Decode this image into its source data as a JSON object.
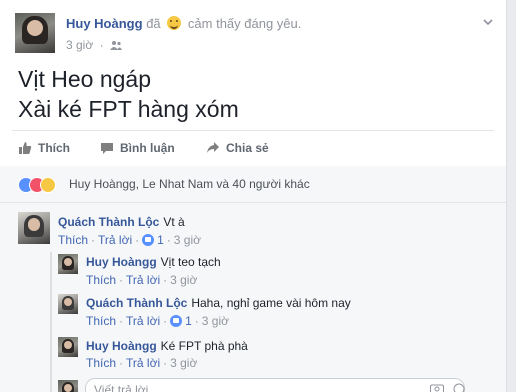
{
  "post": {
    "author": "Huy Hoàngg",
    "feeling_prefix": "đã",
    "feeling_text": "cảm thấy đáng yêu.",
    "time": "3 giờ",
    "text_line1": "Vịt Heo ngáp",
    "text_line2": "Xài ké FPT hàng xóm"
  },
  "actions": {
    "like": "Thích",
    "comment": "Bình luận",
    "share": "Chia sẻ"
  },
  "reactions": {
    "summary": "Huy Hoàngg, Le Nhat Nam và 40 người khác"
  },
  "comments": [
    {
      "author": "Quách Thành Lộc",
      "text": "Vt à",
      "like": "Thích",
      "reply": "Trả lời",
      "likes": "1",
      "time": "3 giờ",
      "replies": [
        {
          "author": "Huy Hoàngg",
          "text": "Vịt teo tạch",
          "like": "Thích",
          "reply": "Trả lời",
          "time": "3 giờ"
        },
        {
          "author": "Quách Thành Lộc",
          "text": "Haha, nghỉ game vài hôm nay",
          "like": "Thích",
          "reply": "Trả lời",
          "likes": "1",
          "time": "3 giờ"
        },
        {
          "author": "Huy Hoàngg",
          "text": "Ké FPT phà phà",
          "like": "Thích",
          "reply": "Trả lời",
          "time": "3 giờ"
        }
      ]
    }
  ],
  "reply_box": {
    "placeholder": "Viết trả lời..."
  },
  "colors": {
    "link": "#365899",
    "meta": "#90949c",
    "like_blue": "#5890ff",
    "love_red": "#f25268"
  }
}
